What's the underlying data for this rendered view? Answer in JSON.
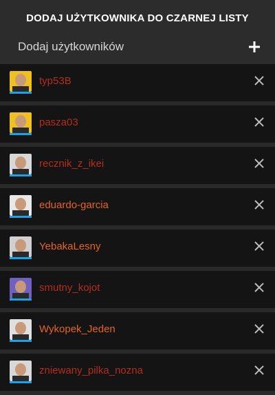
{
  "header": {
    "title": "DODAJ UŻYTKOWNIKA DO CZARNEJ LISTY",
    "add_label": "Dodaj użytkowników",
    "add_icon": "plus-icon"
  },
  "colors": {
    "background": "#2a2a2a",
    "row_background": "#141414",
    "username_red": "#c0392b",
    "username_orange": "#e5641f",
    "avatar_underline": "#1aa3e8",
    "remove_icon": "#bdbdbd"
  },
  "blacklist": {
    "users": [
      {
        "name": "typ53B",
        "color": "#b22e1e",
        "avatar_bg": "#f0c020"
      },
      {
        "name": "pasza03",
        "color": "#b22e1e",
        "avatar_bg": "#f0c020"
      },
      {
        "name": "recznik_z_ikei",
        "color": "#b22e1e",
        "avatar_bg": "#d8d8d8"
      },
      {
        "name": "eduardo-garcia",
        "color": "#e5641f",
        "avatar_bg": "#e8e8e8"
      },
      {
        "name": "YebakaLesny",
        "color": "#e5641f",
        "avatar_bg": "#d0d0d0"
      },
      {
        "name": "smutny_kojot",
        "color": "#b22e1e",
        "avatar_bg": "#7060c0"
      },
      {
        "name": "Wykopek_Jeden",
        "color": "#e5641f",
        "avatar_bg": "#e0e0e0"
      },
      {
        "name": "zniewany_pilka_nozna",
        "color": "#b22e1e",
        "avatar_bg": "#d8d8d8"
      }
    ],
    "remove_icon": "close-icon"
  }
}
